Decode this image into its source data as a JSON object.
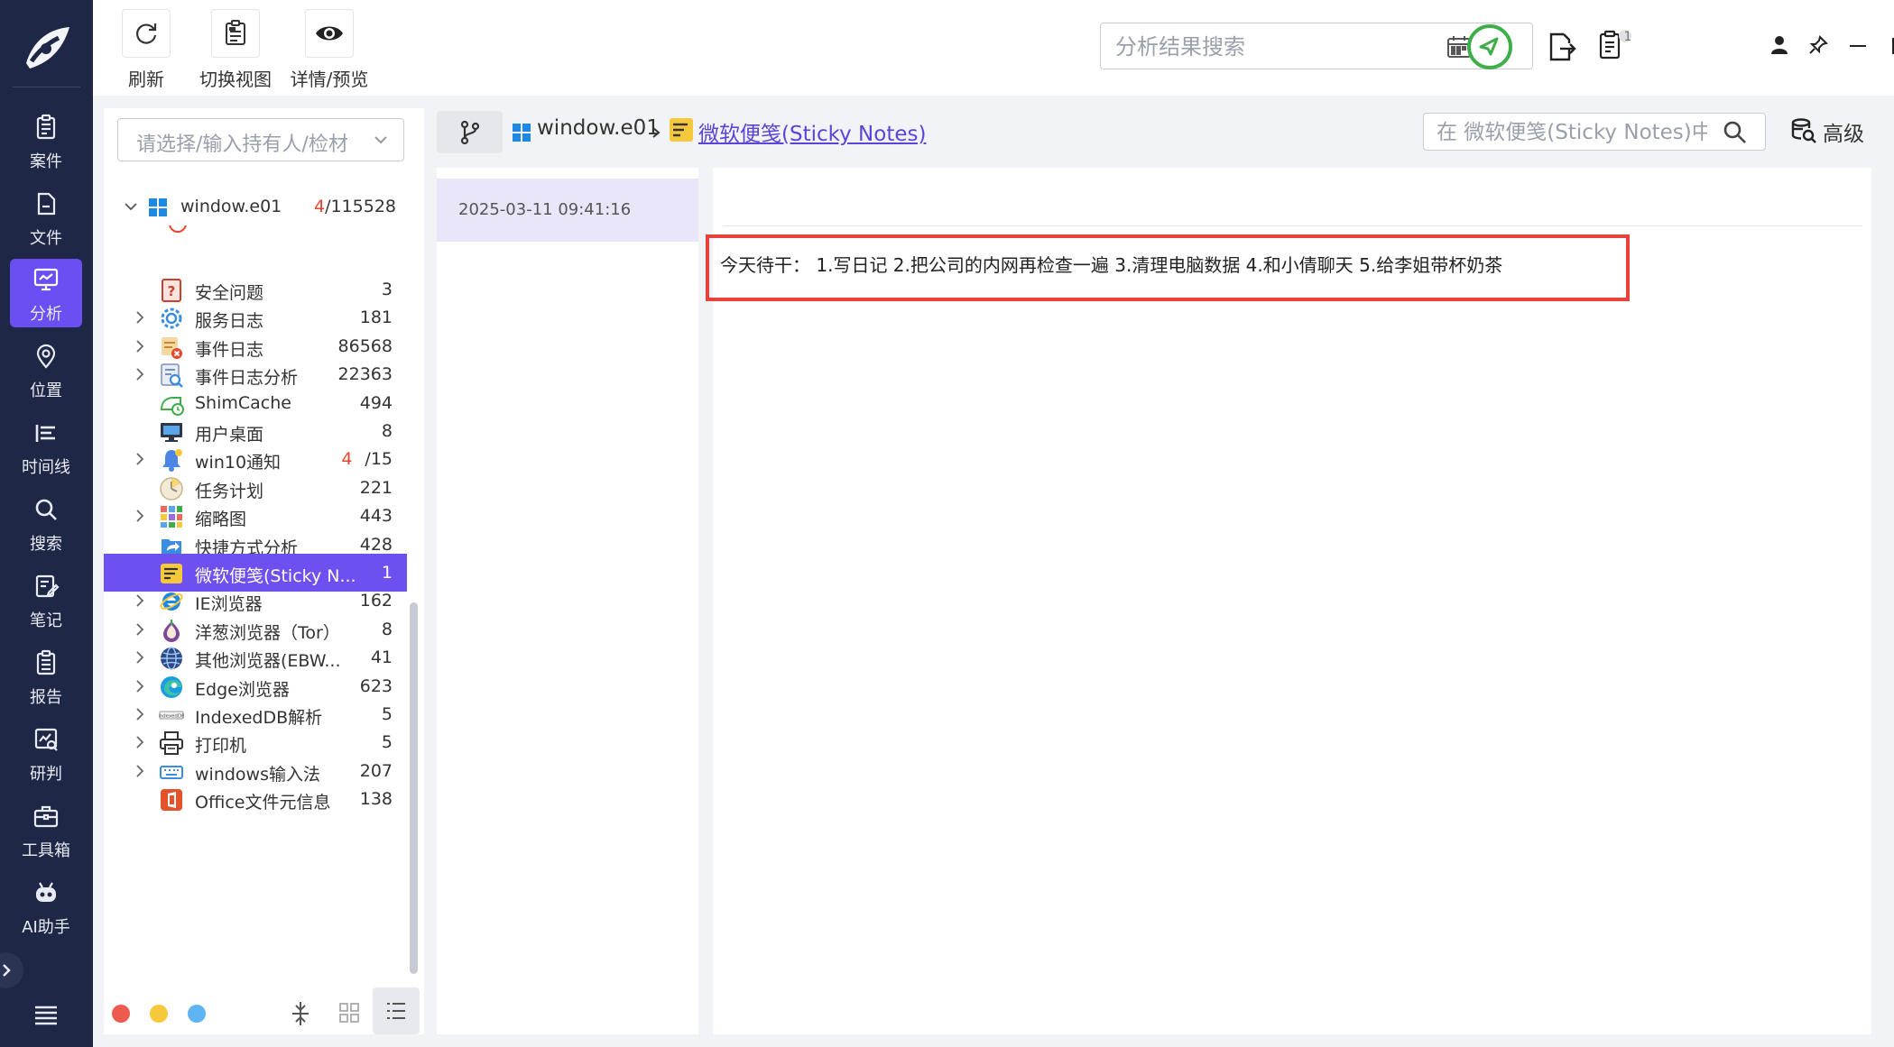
{
  "colors": {
    "nav_bg": "#1e2746",
    "accent": "#6e50f0",
    "highlight_border": "#e8413a",
    "count_red": "#e8452b"
  },
  "nav": {
    "items": [
      {
        "label": "案件",
        "icon": "clipboard-icon"
      },
      {
        "label": "文件",
        "icon": "file-icon"
      },
      {
        "label": "分析",
        "icon": "analysis-monitor-icon",
        "active": true
      },
      {
        "label": "位置",
        "icon": "location-pin-icon"
      },
      {
        "label": "时间线",
        "icon": "timeline-icon"
      },
      {
        "label": "搜索",
        "icon": "search-icon"
      },
      {
        "label": "笔记",
        "icon": "note-edit-icon"
      },
      {
        "label": "报告",
        "icon": "report-icon"
      },
      {
        "label": "研判",
        "icon": "judge-chart-icon"
      },
      {
        "label": "工具箱",
        "icon": "toolbox-icon"
      },
      {
        "label": "AI助手",
        "icon": "robot-icon"
      }
    ]
  },
  "toolbar": {
    "refresh": "刷新",
    "switch_view": "切换视图",
    "detail_preview": "详情/预览",
    "search_placeholder": "分析结果搜索",
    "badge": "1"
  },
  "tree": {
    "select_placeholder": "请选择/输入持有人/检材",
    "root": {
      "name": "window.e01",
      "count_red": "4",
      "count": "/115528"
    },
    "items": [
      {
        "name": "安全问题",
        "count": "3",
        "icon": "security-question-icon",
        "expandable": false
      },
      {
        "name": "服务日志",
        "count": "181",
        "icon": "gear-log-icon",
        "expandable": true
      },
      {
        "name": "事件日志",
        "count": "86568",
        "icon": "event-log-icon",
        "expandable": true
      },
      {
        "name": "事件日志分析",
        "count": "22363",
        "icon": "log-analysis-icon",
        "expandable": true
      },
      {
        "name": "ShimCache",
        "count": "494",
        "icon": "shimcache-icon",
        "expandable": false
      },
      {
        "name": "用户桌面",
        "count": "8",
        "icon": "desktop-icon",
        "expandable": false
      },
      {
        "name": "win10通知",
        "count_red": "4",
        "count": "/15",
        "icon": "bell-icon",
        "expandable": true
      },
      {
        "name": "任务计划",
        "count": "221",
        "icon": "clock-icon",
        "expandable": false
      },
      {
        "name": "缩略图",
        "count": "443",
        "icon": "thumbnail-grid-icon",
        "expandable": true
      },
      {
        "name": "快捷方式分析",
        "count": "428",
        "icon": "shortcut-icon",
        "expandable": false
      },
      {
        "name": "微软便笺(Sticky N...",
        "count": "1",
        "icon": "sticky-note-icon",
        "expandable": false,
        "selected": true
      },
      {
        "name": "IE浏览器",
        "count": "162",
        "icon": "ie-browser-icon",
        "expandable": true
      },
      {
        "name": "洋葱浏览器（Tor）",
        "count": "8",
        "icon": "tor-onion-icon",
        "expandable": true
      },
      {
        "name": "其他浏览器(EBW...",
        "count": "41",
        "icon": "globe-icon",
        "expandable": true
      },
      {
        "name": "Edge浏览器",
        "count": "623",
        "icon": "edge-browser-icon",
        "expandable": true
      },
      {
        "name": "IndexedDB解析",
        "count": "5",
        "icon": "indexeddb-icon",
        "expandable": true
      },
      {
        "name": "打印机",
        "count": "5",
        "icon": "printer-icon",
        "expandable": true
      },
      {
        "name": "windows输入法",
        "count": "207",
        "icon": "keyboard-icon",
        "expandable": true
      },
      {
        "name": "Office文件元信息",
        "count": "138",
        "icon": "office-icon",
        "expandable": false
      }
    ]
  },
  "breadcrumb": {
    "root": "window.e01",
    "current": "微软便笺(Sticky Notes)",
    "search_placeholder": "在 微软便笺(Sticky Notes)中搜索",
    "advanced": "高级"
  },
  "list": {
    "timestamp": "2025-03-11 09:41:16"
  },
  "detail": {
    "note_text": "今天待干： 1.写日记 2.把公司的内网再检查一遍 3.清理电脑数据 4.和小倩聊天 5.给李姐带杯奶茶"
  }
}
